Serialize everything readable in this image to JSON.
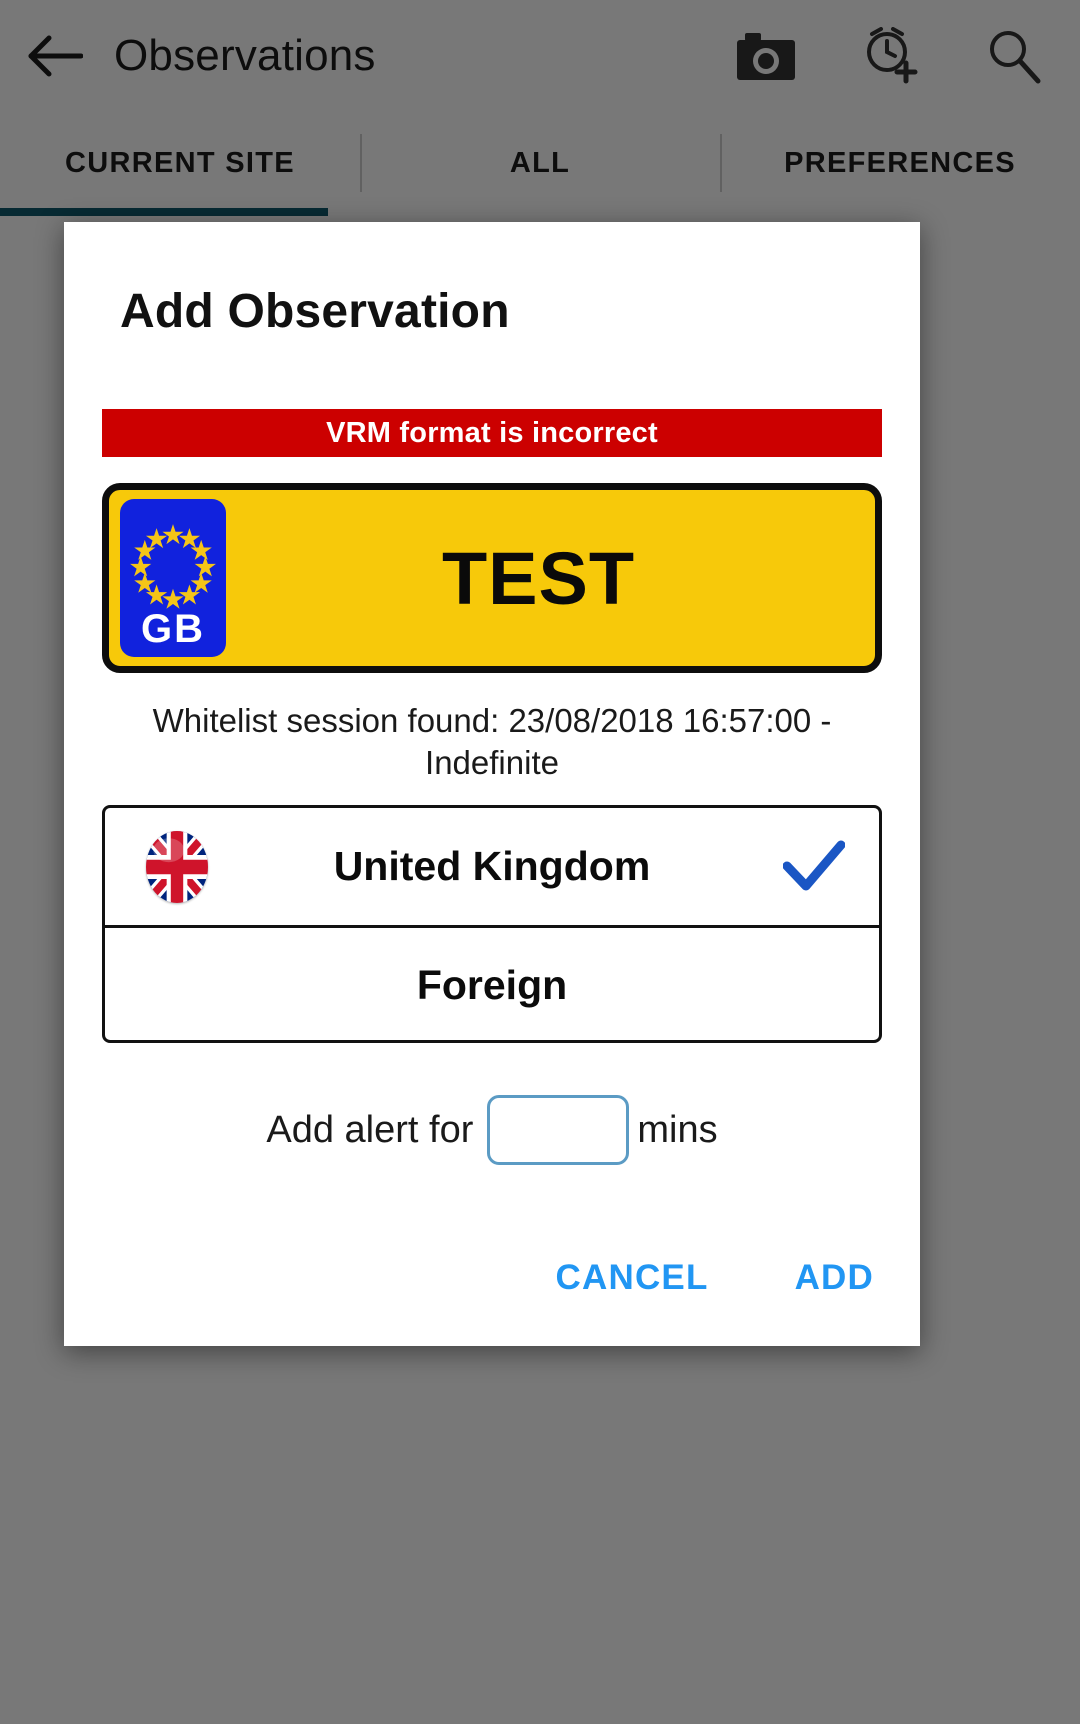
{
  "app": {
    "title": "Observations",
    "back_icon": "back-arrow-icon",
    "actions": [
      {
        "name": "camera-icon",
        "label": "Camera"
      },
      {
        "name": "add-alarm-icon",
        "label": "Add alarm"
      },
      {
        "name": "search-icon",
        "label": "Search"
      }
    ],
    "tabs": [
      {
        "label": "CURRENT SITE",
        "selected": true
      },
      {
        "label": "ALL",
        "selected": false
      },
      {
        "label": "PREFERENCES",
        "selected": false
      }
    ],
    "tab_indicator_color": "#0f5a6e"
  },
  "dialog": {
    "title": "Add Observation",
    "error": {
      "message": "VRM format is incorrect",
      "background": "#cc0000",
      "text_color": "#ffffff"
    },
    "plate": {
      "registration": "TEST",
      "country_code": "GB",
      "plate_color": "#f7c90a",
      "badge_color": "#1122dd",
      "border_color": "#0d0d0d",
      "star_count": 12
    },
    "whitelist_note": "Whitelist session found: 23/08/2018 16:57:00 - Indefinite",
    "country_list": [
      {
        "label": "United Kingdom",
        "flag": "uk-flag-icon",
        "selected": true
      },
      {
        "label": "Foreign",
        "flag": "",
        "selected": false
      }
    ],
    "check_color": "#1a56c4",
    "alert": {
      "label": "Add alert for",
      "value": "",
      "placeholder": "",
      "unit": "mins",
      "border_color": "#5b9bc4"
    },
    "buttons": {
      "cancel": "CANCEL",
      "add": "ADD",
      "color": "#2196f3"
    }
  }
}
